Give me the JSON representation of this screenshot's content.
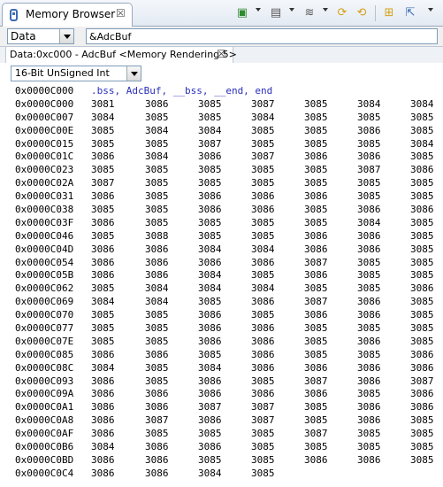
{
  "view": {
    "title": "Memory Browser",
    "close_glyph": "☒"
  },
  "toolbar": {
    "icons": [
      "run-to-line-icon",
      "dropdown-arrow-icon",
      "memory-save-icon",
      "dropdown-arrow-icon",
      "memory-load-icon",
      "dropdown-arrow-icon",
      "sync-icon",
      "refresh-icon",
      "new-tab-icon",
      "export-icon",
      "view-menu-icon"
    ]
  },
  "address_bar": {
    "memory_space": "Data",
    "expression": "&AdcBuf"
  },
  "rendering_tab": {
    "label": "Data:0xc000 - AdcBuf <Memory Rendering 5>",
    "close_glyph": "☒"
  },
  "format": {
    "selected": "16-Bit UnSigned Int"
  },
  "memory": {
    "symbol_row": {
      "address": "0x0000C000",
      "symbols": ".bss, AdcBuf, __bss, __end, end"
    },
    "rows": [
      {
        "address": "0x0000C000",
        "values": [
          "3081",
          "3086",
          "3085",
          "3087",
          "3085",
          "3084",
          "3084"
        ]
      },
      {
        "address": "0x0000C007",
        "values": [
          "3084",
          "3085",
          "3085",
          "3084",
          "3085",
          "3085",
          "3085"
        ]
      },
      {
        "address": "0x0000C00E",
        "values": [
          "3085",
          "3084",
          "3084",
          "3085",
          "3085",
          "3086",
          "3085"
        ]
      },
      {
        "address": "0x0000C015",
        "values": [
          "3085",
          "3085",
          "3087",
          "3085",
          "3085",
          "3085",
          "3084"
        ]
      },
      {
        "address": "0x0000C01C",
        "values": [
          "3086",
          "3084",
          "3086",
          "3087",
          "3086",
          "3086",
          "3085"
        ]
      },
      {
        "address": "0x0000C023",
        "values": [
          "3085",
          "3085",
          "3085",
          "3085",
          "3085",
          "3087",
          "3086"
        ]
      },
      {
        "address": "0x0000C02A",
        "values": [
          "3087",
          "3085",
          "3085",
          "3085",
          "3085",
          "3085",
          "3085"
        ]
      },
      {
        "address": "0x0000C031",
        "values": [
          "3086",
          "3085",
          "3086",
          "3086",
          "3086",
          "3085",
          "3085"
        ]
      },
      {
        "address": "0x0000C038",
        "values": [
          "3085",
          "3085",
          "3086",
          "3086",
          "3085",
          "3086",
          "3086"
        ]
      },
      {
        "address": "0x0000C03F",
        "values": [
          "3086",
          "3085",
          "3085",
          "3085",
          "3085",
          "3084",
          "3085"
        ]
      },
      {
        "address": "0x0000C046",
        "values": [
          "3085",
          "3088",
          "3085",
          "3085",
          "3086",
          "3086",
          "3085"
        ]
      },
      {
        "address": "0x0000C04D",
        "values": [
          "3086",
          "3086",
          "3084",
          "3084",
          "3086",
          "3086",
          "3085"
        ]
      },
      {
        "address": "0x0000C054",
        "values": [
          "3086",
          "3086",
          "3086",
          "3086",
          "3087",
          "3085",
          "3085"
        ]
      },
      {
        "address": "0x0000C05B",
        "values": [
          "3086",
          "3086",
          "3084",
          "3085",
          "3086",
          "3085",
          "3085"
        ]
      },
      {
        "address": "0x0000C062",
        "values": [
          "3085",
          "3084",
          "3084",
          "3084",
          "3085",
          "3085",
          "3086"
        ]
      },
      {
        "address": "0x0000C069",
        "values": [
          "3084",
          "3084",
          "3085",
          "3086",
          "3087",
          "3086",
          "3085"
        ]
      },
      {
        "address": "0x0000C070",
        "values": [
          "3085",
          "3085",
          "3086",
          "3085",
          "3086",
          "3086",
          "3085"
        ]
      },
      {
        "address": "0x0000C077",
        "values": [
          "3085",
          "3085",
          "3086",
          "3086",
          "3085",
          "3085",
          "3085"
        ]
      },
      {
        "address": "0x0000C07E",
        "values": [
          "3085",
          "3085",
          "3086",
          "3086",
          "3085",
          "3086",
          "3085"
        ]
      },
      {
        "address": "0x0000C085",
        "values": [
          "3086",
          "3086",
          "3085",
          "3086",
          "3085",
          "3085",
          "3086"
        ]
      },
      {
        "address": "0x0000C08C",
        "values": [
          "3084",
          "3085",
          "3084",
          "3086",
          "3086",
          "3086",
          "3086"
        ]
      },
      {
        "address": "0x0000C093",
        "values": [
          "3086",
          "3085",
          "3086",
          "3085",
          "3087",
          "3086",
          "3087"
        ]
      },
      {
        "address": "0x0000C09A",
        "values": [
          "3086",
          "3086",
          "3086",
          "3086",
          "3086",
          "3085",
          "3086"
        ]
      },
      {
        "address": "0x0000C0A1",
        "values": [
          "3086",
          "3086",
          "3087",
          "3087",
          "3085",
          "3086",
          "3086"
        ]
      },
      {
        "address": "0x0000C0A8",
        "values": [
          "3086",
          "3087",
          "3086",
          "3087",
          "3085",
          "3086",
          "3085"
        ]
      },
      {
        "address": "0x0000C0AF",
        "values": [
          "3086",
          "3085",
          "3085",
          "3085",
          "3087",
          "3085",
          "3085"
        ]
      },
      {
        "address": "0x0000C0B6",
        "values": [
          "3084",
          "3086",
          "3086",
          "3085",
          "3085",
          "3085",
          "3085"
        ]
      },
      {
        "address": "0x0000C0BD",
        "values": [
          "3086",
          "3086",
          "3085",
          "3085",
          "3086",
          "3086",
          "3085"
        ]
      },
      {
        "address": "0x0000C0C4",
        "values": [
          "3086",
          "3086",
          "3084",
          "3085"
        ]
      }
    ]
  }
}
